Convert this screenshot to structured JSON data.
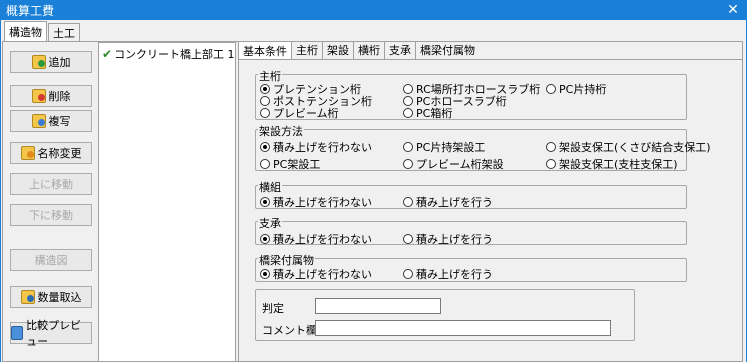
{
  "window": {
    "title": "概算工費",
    "close": "✕"
  },
  "outer_tabs": [
    "構造物",
    "土工"
  ],
  "left_buttons": {
    "add": "追加",
    "delete": "削除",
    "copy": "複写",
    "rename": "名称変更",
    "move_up": "上に移動",
    "move_down": "下に移動",
    "structure": "構造図",
    "quantity": "数量取込",
    "compare": "比較プレビュー"
  },
  "tree": {
    "item": "コンクリート橋上部工 1"
  },
  "inner_tabs": [
    "基本条件",
    "主桁",
    "架設",
    "横桁",
    "支承",
    "橋梁付属物"
  ],
  "main_girder": {
    "title": "主桁",
    "options": [
      "プレテンション桁",
      "ポストテンション桁",
      "プレビーム桁",
      "RC場所打ホロースラブ桁",
      "PCホロースラブ桁",
      "PC箱桁",
      "PC片持桁"
    ],
    "selected": "プレテンション桁"
  },
  "erection": {
    "title": "架設方法",
    "options": [
      "積み上げを行わない",
      "PC架設工",
      "PC片持架設工",
      "プレビーム桁架設",
      "架設支保工(くさび結合支保工)",
      "架設支保工(支柱支保工)"
    ],
    "selected": "積み上げを行わない"
  },
  "cross_girder": {
    "title": "横組",
    "options": [
      "積み上げを行わない",
      "積み上げを行う"
    ],
    "selected": "積み上げを行わない"
  },
  "bearing": {
    "title": "支承",
    "options": [
      "積み上げを行わない",
      "積み上げを行う"
    ],
    "selected": "積み上げを行わない"
  },
  "accessories": {
    "title": "橋梁付属物",
    "options": [
      "積み上げを行わない",
      "積み上げを行う"
    ],
    "selected": "積み上げを行わない"
  },
  "judgement": {
    "label": "判定",
    "value": ""
  },
  "comment": {
    "label": "コメント欄",
    "value": ""
  }
}
